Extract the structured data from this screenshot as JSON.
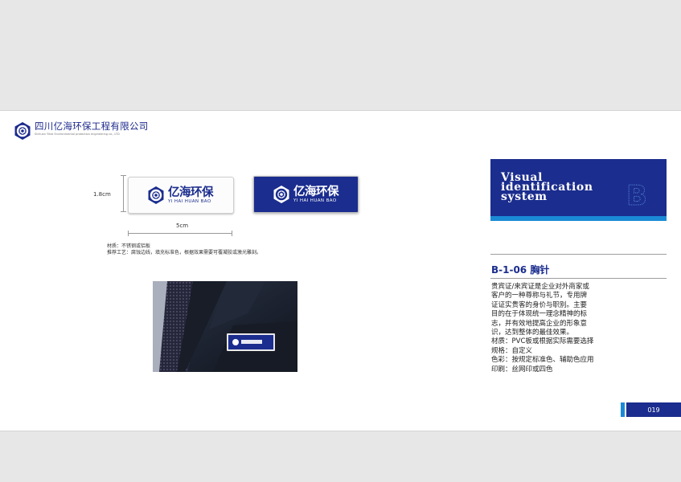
{
  "header": {
    "company_name": "四川亿海环保工程有限公司",
    "company_name_en": "Sichuan Yihai Environmental protection engineering co., LTD"
  },
  "badges": {
    "brand_cn": "亿海环保",
    "brand_en": "YI HAI HUAN BAO",
    "height_label": "1.8cm",
    "width_label": "5cm"
  },
  "material_note": {
    "line1": "材质：不锈钢或铝板",
    "line2": "推荐工艺：腐蚀边线，填充标准色，根据效果需要可覆凝胶或激光雕刻。"
  },
  "vis_title": {
    "line1": "Visual",
    "line2": "identification",
    "line3": "system",
    "letter": "B"
  },
  "section": {
    "title": "B-1-06 胸针",
    "body": [
      "贵宾证/来宾证是企业对外商家或",
      "客户的一种尊称与礼节，专用牌",
      "证证实贵客的身价与职别。主要",
      "目的在于体现统一理念精神的标",
      "志，并有效地提高企业的形象意",
      "识，达到整体的最佳效果。",
      "材质：PVC板或根据实际需要选择",
      "规格：自定义",
      "色彩：按规定标准色、辅助色应用",
      "印刷：丝网印或四色"
    ]
  },
  "page_number": "019",
  "colors": {
    "brand_blue": "#1b2d8e",
    "accent_blue": "#1b8ad6",
    "page_bg": "#e7e7e7"
  },
  "icons": {
    "logo": "hexagon-logo-icon"
  }
}
